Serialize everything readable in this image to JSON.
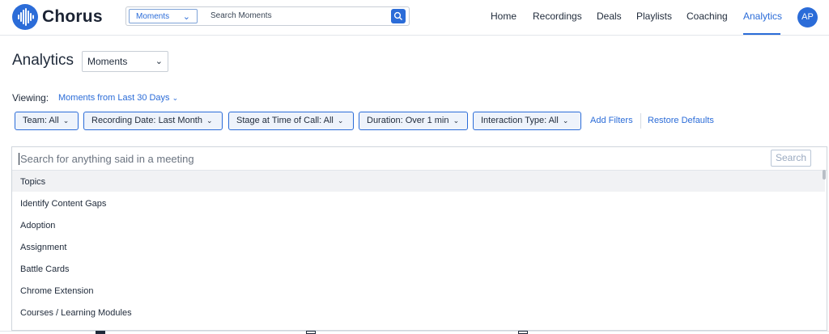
{
  "brand": {
    "name": "Chorus",
    "color": "#2b6cd8"
  },
  "topbar": {
    "search": {
      "scope": "Moments",
      "placeholder": "Search Moments"
    },
    "nav": [
      {
        "label": "Home"
      },
      {
        "label": "Recordings"
      },
      {
        "label": "Deals"
      },
      {
        "label": "Playlists"
      },
      {
        "label": "Coaching"
      },
      {
        "label": "Analytics",
        "active": true
      }
    ],
    "avatar_initials": "AP"
  },
  "page": {
    "title": "Analytics",
    "view_select": "Moments",
    "viewing_label": "Viewing:",
    "viewing_value": "Moments from Last 30 Days"
  },
  "filters": [
    {
      "label": "Team:",
      "value": "All"
    },
    {
      "label": "Recording Date:",
      "value": "Last Month"
    },
    {
      "label": "Stage at Time of Call:",
      "value": "All"
    },
    {
      "label": "Duration:",
      "value": "Over 1 min"
    },
    {
      "label": "Interaction Type:",
      "value": "All"
    }
  ],
  "filter_links": {
    "add": "Add Filters",
    "restore": "Restore Defaults"
  },
  "dropdown": {
    "placeholder": "Search for anything said in a meeting",
    "search_button": "Search",
    "options": [
      "Topics",
      "Identify Content Gaps",
      "Adoption",
      "Assignment",
      "Battle Cards",
      "Chrome Extension",
      "Courses / Learning Modules"
    ]
  }
}
